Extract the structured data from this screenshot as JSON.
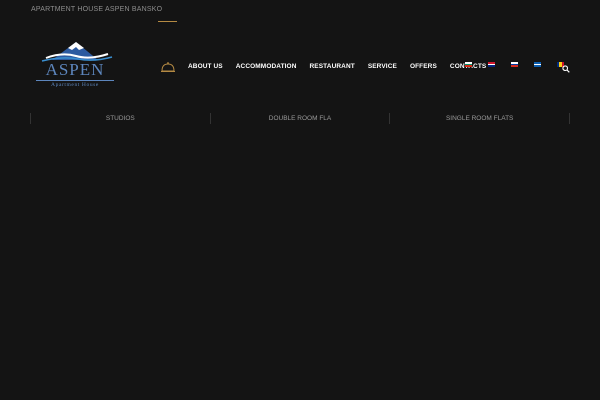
{
  "topbar": {
    "text": "APARTMENT HOUSE ASPEN BANSKO"
  },
  "logo": {
    "word": "ASPEN",
    "subtitle": "Apartment House"
  },
  "nav": {
    "items": [
      {
        "label": "ABOUT US"
      },
      {
        "label": "ACCOMMODATION"
      },
      {
        "label": "RESTAURANT"
      },
      {
        "label": "SERVICE"
      },
      {
        "label": "OFFERS"
      },
      {
        "label": "CONTACTS"
      }
    ]
  },
  "flags": [
    {
      "name": "bulgaria-flag-icon",
      "colors": [
        "#ffffff",
        "#00966e",
        "#d62612"
      ]
    },
    {
      "name": "uk-flag-icon",
      "colors": [
        "#cf142b",
        "#ffffff",
        "#00247d"
      ]
    },
    {
      "name": "russia-flag-icon",
      "colors": [
        "#ffffff",
        "#0039a6",
        "#d52b1e"
      ]
    },
    {
      "name": "greece-flag-icon",
      "colors": [
        "#0d5eaf",
        "#ffffff",
        "#0d5eaf"
      ]
    },
    {
      "name": "romania-flag-icon",
      "colors": [
        "#002b7f",
        "#fcd116",
        "#ce1126"
      ]
    }
  ],
  "subtabs": [
    {
      "label": "STUDIOS"
    },
    {
      "label": "DOUBLE ROOM FLA"
    },
    {
      "label": "SINGLE ROOM FLATS"
    }
  ],
  "colors": {
    "background": "#141414",
    "accent": "#b58a43",
    "logo": "#5d86bd"
  }
}
